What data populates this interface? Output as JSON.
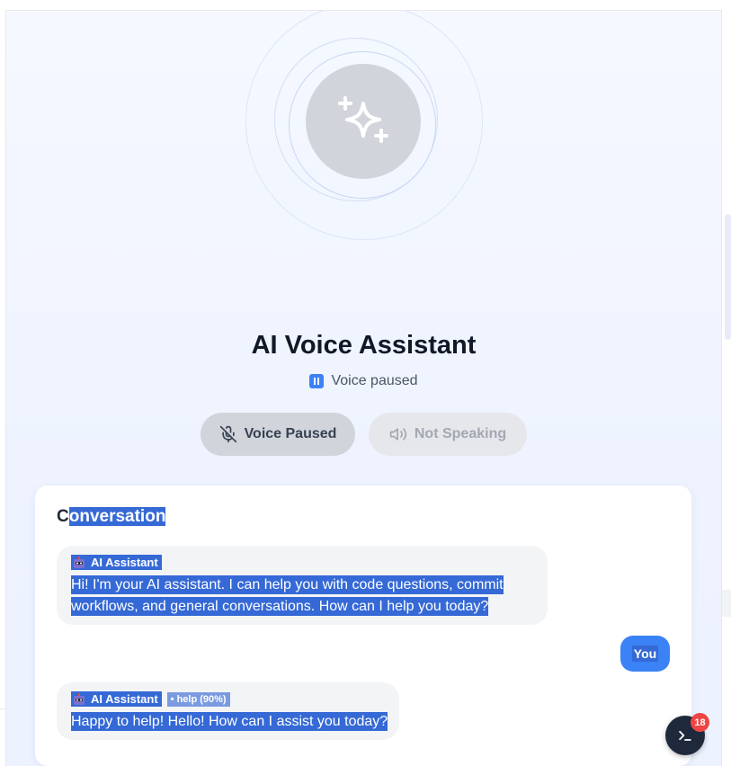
{
  "header": {
    "title": "AI Voice Assistant",
    "status_text": "Voice paused"
  },
  "controls": {
    "voice_button_label": "Voice Paused",
    "speak_button_label": "Not Speaking"
  },
  "conversation": {
    "title_first_letter": "C",
    "title_rest": "onversation",
    "messages": [
      {
        "sender": "AI Assistant",
        "meta": "",
        "text": "Hi! I'm your AI assistant. I can help you with code questions, commit workflows, and general conversations. How can I help you today?"
      },
      {
        "sender": "You",
        "text": ""
      },
      {
        "sender": "AI Assistant",
        "meta": "• help (90%)",
        "text": "Happy to help! Hello! How can I assist you today?"
      }
    ]
  },
  "terminal": {
    "badge_count": "18",
    "icon": "terminal-icon"
  },
  "colors": {
    "accent": "#3b82f6",
    "selection": "#3569d6",
    "badge": "#ef4444",
    "fab": "#1e293b"
  }
}
